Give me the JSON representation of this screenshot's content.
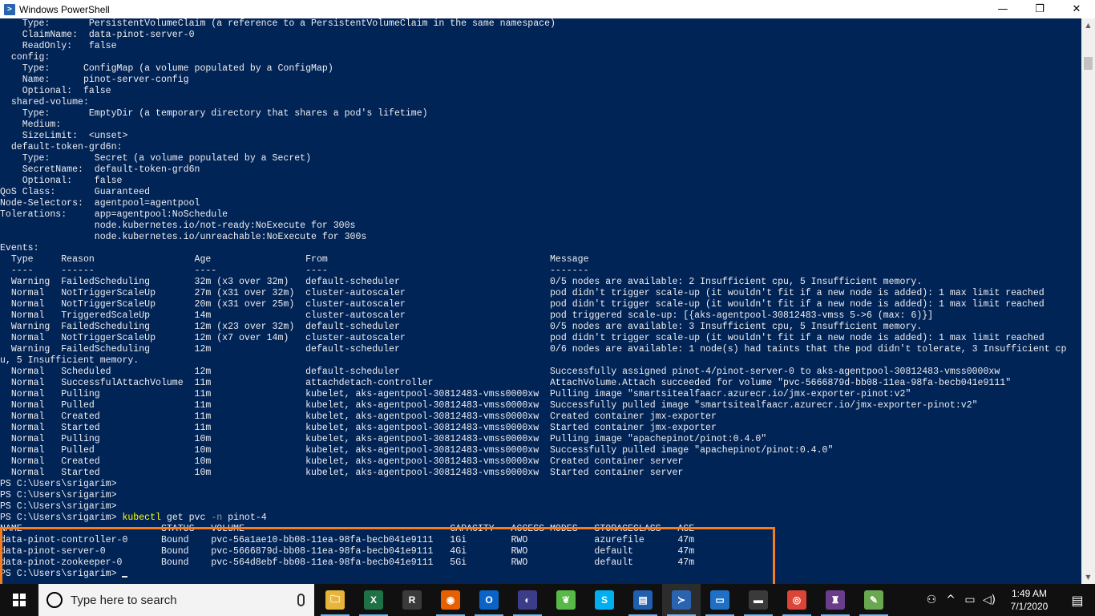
{
  "window": {
    "title": "Windows PowerShell",
    "minimize_glyph": "—",
    "maximize_glyph": "❐",
    "close_glyph": "✕"
  },
  "console": {
    "lines": [
      "    Type:       PersistentVolumeClaim (a reference to a PersistentVolumeClaim in the same namespace)",
      "    ClaimName:  data-pinot-server-0",
      "    ReadOnly:   false",
      "  config:",
      "    Type:      ConfigMap (a volume populated by a ConfigMap)",
      "    Name:      pinot-server-config",
      "    Optional:  false",
      "  shared-volume:",
      "    Type:       EmptyDir (a temporary directory that shares a pod's lifetime)",
      "    Medium:",
      "    SizeLimit:  <unset>",
      "  default-token-grd6n:",
      "    Type:        Secret (a volume populated by a Secret)",
      "    SecretName:  default-token-grd6n",
      "    Optional:    false",
      "QoS Class:       Guaranteed",
      "Node-Selectors:  agentpool=agentpool",
      "Tolerations:     app=agentpool:NoSchedule",
      "                 node.kubernetes.io/not-ready:NoExecute for 300s",
      "                 node.kubernetes.io/unreachable:NoExecute for 300s",
      "Events:",
      "  Type     Reason                  Age                 From                                        Message",
      "  ----     ------                  ----                ----                                        -------",
      "  Warning  FailedScheduling        32m (x3 over 32m)   default-scheduler                           0/5 nodes are available: 2 Insufficient cpu, 5 Insufficient memory.",
      "  Normal   NotTriggerScaleUp       27m (x31 over 32m)  cluster-autoscaler                          pod didn't trigger scale-up (it wouldn't fit if a new node is added): 1 max limit reached",
      "  Normal   NotTriggerScaleUp       20m (x31 over 25m)  cluster-autoscaler                          pod didn't trigger scale-up (it wouldn't fit if a new node is added): 1 max limit reached",
      "  Normal   TriggeredScaleUp        14m                 cluster-autoscaler                          pod triggered scale-up: [{aks-agentpool-30812483-vmss 5->6 (max: 6)}]",
      "  Warning  FailedScheduling        12m (x23 over 32m)  default-scheduler                           0/5 nodes are available: 3 Insufficient cpu, 5 Insufficient memory.",
      "  Normal   NotTriggerScaleUp       12m (x7 over 14m)   cluster-autoscaler                          pod didn't trigger scale-up (it wouldn't fit if a new node is added): 1 max limit reached",
      "  Warning  FailedScheduling        12m                 default-scheduler                           0/6 nodes are available: 1 node(s) had taints that the pod didn't tolerate, 3 Insufficient cp",
      "u, 5 Insufficient memory.",
      "  Normal   Scheduled               12m                 default-scheduler                           Successfully assigned pinot-4/pinot-server-0 to aks-agentpool-30812483-vmss0000xw",
      "  Normal   SuccessfulAttachVolume  11m                 attachdetach-controller                     AttachVolume.Attach succeeded for volume \"pvc-5666879d-bb08-11ea-98fa-becb041e9111\"",
      "  Normal   Pulling                 11m                 kubelet, aks-agentpool-30812483-vmss0000xw  Pulling image \"smartsitealfaacr.azurecr.io/jmx-exporter-pinot:v2\"",
      "  Normal   Pulled                  11m                 kubelet, aks-agentpool-30812483-vmss0000xw  Successfully pulled image \"smartsitealfaacr.azurecr.io/jmx-exporter-pinot:v2\"",
      "  Normal   Created                 11m                 kubelet, aks-agentpool-30812483-vmss0000xw  Created container jmx-exporter",
      "  Normal   Started                 11m                 kubelet, aks-agentpool-30812483-vmss0000xw  Started container jmx-exporter",
      "  Normal   Pulling                 10m                 kubelet, aks-agentpool-30812483-vmss0000xw  Pulling image \"apachepinot/pinot:0.4.0\"",
      "  Normal   Pulled                  10m                 kubelet, aks-agentpool-30812483-vmss0000xw  Successfully pulled image \"apachepinot/pinot:0.4.0\"",
      "  Normal   Created                 10m                 kubelet, aks-agentpool-30812483-vmss0000xw  Created container server",
      "  Normal   Started                 10m                 kubelet, aks-agentpool-30812483-vmss0000xw  Started container server",
      "PS C:\\Users\\srigarim>",
      "PS C:\\Users\\srigarim>",
      "PS C:\\Users\\srigarim>"
    ],
    "command": {
      "prompt": "PS C:\\Users\\srigarim> ",
      "cmd": "kubectl",
      "args": " get pvc ",
      "flag": "-n",
      "value": " pinot-4"
    },
    "pvc_lines": [
      "NAME                         STATUS   VOLUME                                     CAPACITY   ACCESS MODES   STORAGECLASS   AGE",
      "data-pinot-controller-0      Bound    pvc-56a1ae10-bb08-11ea-98fa-becb041e9111   1Gi        RWO            azurefile      47m",
      "data-pinot-server-0          Bound    pvc-5666879d-bb08-11ea-98fa-becb041e9111   4Gi        RWO            default        47m",
      "data-pinot-zookeeper-0       Bound    pvc-564d8ebf-bb08-11ea-98fa-becb041e9111   5Gi        RWO            default        47m"
    ],
    "final_prompt": "PS C:\\Users\\srigarim> "
  },
  "taskbar": {
    "search_placeholder": "Type here to search",
    "apps": [
      {
        "icon": "file-explorer-icon",
        "glyph": "🗀",
        "color": "#e8b43a"
      },
      {
        "icon": "excel-icon",
        "glyph": "X",
        "color": "#1e7145"
      },
      {
        "icon": "r-icon",
        "glyph": "R",
        "color": "#3a3a3a"
      },
      {
        "icon": "firefox-icon",
        "glyph": "◉",
        "color": "#e66000"
      },
      {
        "icon": "outlook-icon",
        "glyph": "O",
        "color": "#0a64c8"
      },
      {
        "icon": "eclipse-icon",
        "glyph": "◐",
        "color": "#3b3d8a"
      },
      {
        "icon": "leaf-icon",
        "glyph": "❦",
        "color": "#58b947"
      },
      {
        "icon": "skype-icon",
        "glyph": "S",
        "color": "#00aff0"
      },
      {
        "icon": "document-icon",
        "glyph": "▤",
        "color": "#1f5fae"
      },
      {
        "icon": "powershell-icon",
        "glyph": "≻",
        "color": "#2a64b0"
      },
      {
        "icon": "remote-desktop-icon",
        "glyph": "▭",
        "color": "#1f6fc5"
      },
      {
        "icon": "terminal-icon",
        "glyph": "▬",
        "color": "#3a3a3a"
      },
      {
        "icon": "chrome-icon",
        "glyph": "◎",
        "color": "#db4437"
      },
      {
        "icon": "game-icon",
        "glyph": "♜",
        "color": "#6b3c8c"
      },
      {
        "icon": "notepad-icon",
        "glyph": "✎",
        "color": "#6aa84f"
      }
    ],
    "time": "1:49 AM",
    "date": "7/1/2020"
  },
  "colors": {
    "console_bg": "#012456",
    "console_fg": "#eeedf0",
    "command_color": "#fefe00",
    "highlight_border": "#f57c1f"
  }
}
